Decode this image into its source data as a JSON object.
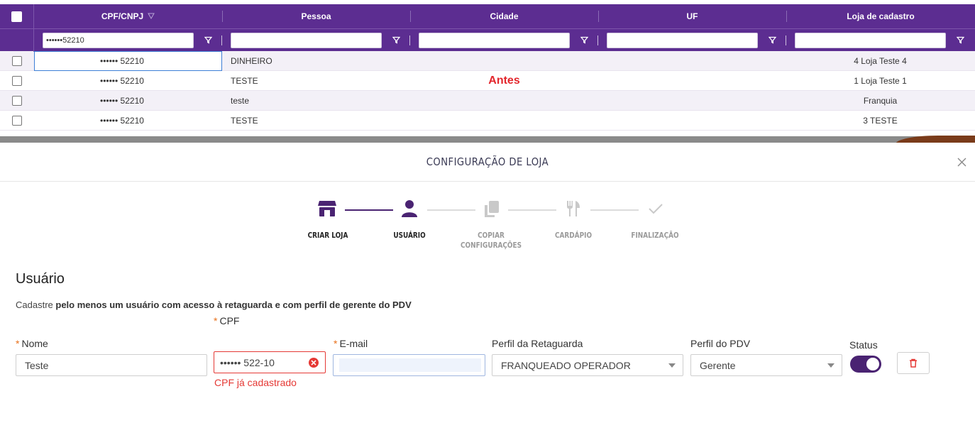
{
  "grid": {
    "columns": [
      "CPF/CNPJ",
      "Pessoa",
      "Cidade",
      "UF",
      "Loja de cadastro"
    ],
    "filters": {
      "cpf_value": "••••••52210"
    },
    "rows": [
      {
        "cpf": "•••••• 52210",
        "pessoa": "DINHEIRO",
        "cidade": "",
        "uf": "",
        "loja": "4 Loja Teste 4"
      },
      {
        "cpf": "•••••• 52210",
        "pessoa": "TESTE",
        "cidade": "",
        "uf": "",
        "loja": "1 Loja Teste 1"
      },
      {
        "cpf": "•••••• 52210",
        "pessoa": "teste",
        "cidade": "",
        "uf": "",
        "loja": "Franquia"
      },
      {
        "cpf": "•••••• 52210",
        "pessoa": "TESTE",
        "cidade": "",
        "uf": "",
        "loja": "3 TESTE"
      }
    ],
    "annotation": "Antes"
  },
  "modal": {
    "title": "CONFIGURAÇÃO DE LOJA",
    "steps": [
      {
        "label_line1": "CRIAR LOJA",
        "label_line2": "",
        "icon": "store-icon",
        "state": "done"
      },
      {
        "label_line1": "USUÁRIO",
        "label_line2": "",
        "icon": "user-icon",
        "state": "active"
      },
      {
        "label_line1": "COPIAR",
        "label_line2": "CONFIGURAÇÕES",
        "icon": "copy-icon",
        "state": "pending"
      },
      {
        "label_line1": "CARDÁPIO",
        "label_line2": "",
        "icon": "cutlery-icon",
        "state": "pending"
      },
      {
        "label_line1": "FINALIZAÇÃO",
        "label_line2": "",
        "icon": "check-icon",
        "state": "pending"
      }
    ],
    "section_title": "Usuário",
    "section_desc_prefix": "Cadastre ",
    "section_desc_bold": "pelo menos um usuário com acesso à retaguarda e com perfil de gerente do PDV",
    "form": {
      "nome_label": "Nome",
      "nome_value": "Teste",
      "cpf_label": "CPF",
      "cpf_value": "•••••• 522-10",
      "cpf_error": "CPF já cadastrado",
      "email_label": "E-mail",
      "email_value": "",
      "perfil_ret_label": "Perfil da Retaguarda",
      "perfil_ret_value": "FRANQUEADO OPERADOR",
      "perfil_pdv_label": "Perfil do PDV",
      "perfil_pdv_value": "Gerente",
      "status_label": "Status",
      "status_on": true
    }
  },
  "colors": {
    "header_purple": "#5c2d91",
    "toggle_purple": "#4a2372",
    "error_red": "#e53935",
    "required_orange": "#e8711c"
  }
}
